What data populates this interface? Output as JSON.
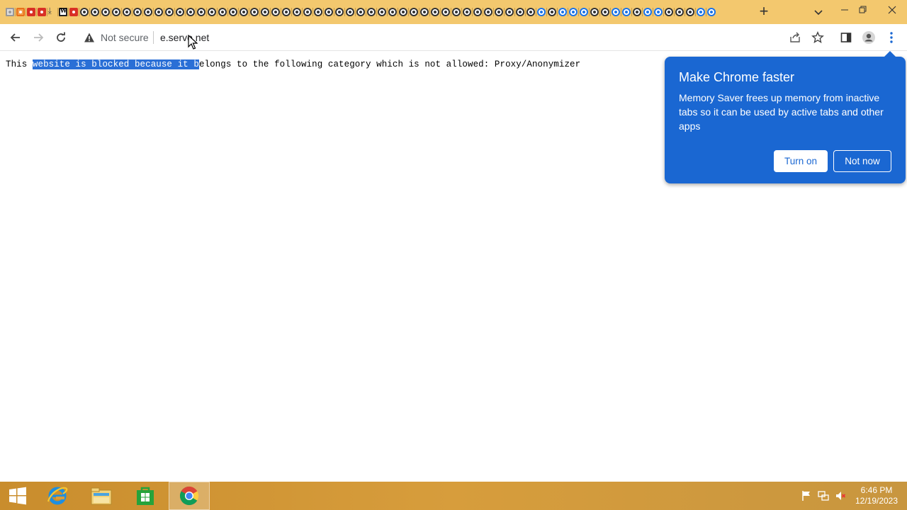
{
  "browser": {
    "tab_favicons": [
      "doc",
      "orange",
      "red",
      "red",
      "dl",
      "w",
      "red",
      "g",
      "g",
      "g",
      "g",
      "g",
      "g",
      "g",
      "g",
      "g",
      "g",
      "g",
      "g",
      "g",
      "g",
      "g",
      "g",
      "g",
      "g",
      "g",
      "g",
      "g",
      "g",
      "g",
      "g",
      "g",
      "g",
      "g",
      "g",
      "g",
      "g",
      "g",
      "g",
      "g",
      "g",
      "g",
      "g",
      "g",
      "g",
      "g",
      "g",
      "g",
      "g",
      "g",
      "blue",
      "g",
      "blue",
      "blue",
      "blue",
      "g",
      "g",
      "blue",
      "blue",
      "g",
      "blue",
      "blue",
      "g",
      "g",
      "g",
      "blue",
      "blue"
    ],
    "tab_favicon_icon": "vortex-icon",
    "omnibox": {
      "security_label": "Not secure",
      "url": "e.servo.net"
    }
  },
  "page": {
    "message_before": "This ",
    "message_selected": "website is blocked because it b",
    "message_after": "elongs to the following category which is not allowed: Proxy/Anonymizer"
  },
  "bubble": {
    "title": "Make Chrome faster",
    "body": "Memory Saver frees up memory from inactive tabs so it can be used by active tabs and other apps",
    "turn_on_label": "Turn on",
    "not_now_label": "Not now"
  },
  "taskbar": {
    "time": "6:46 PM",
    "date": "12/19/2023"
  },
  "colors": {
    "tabstrip": "#f3c86e",
    "bubble": "#1a67d2",
    "selection": "#2a6fd6"
  }
}
